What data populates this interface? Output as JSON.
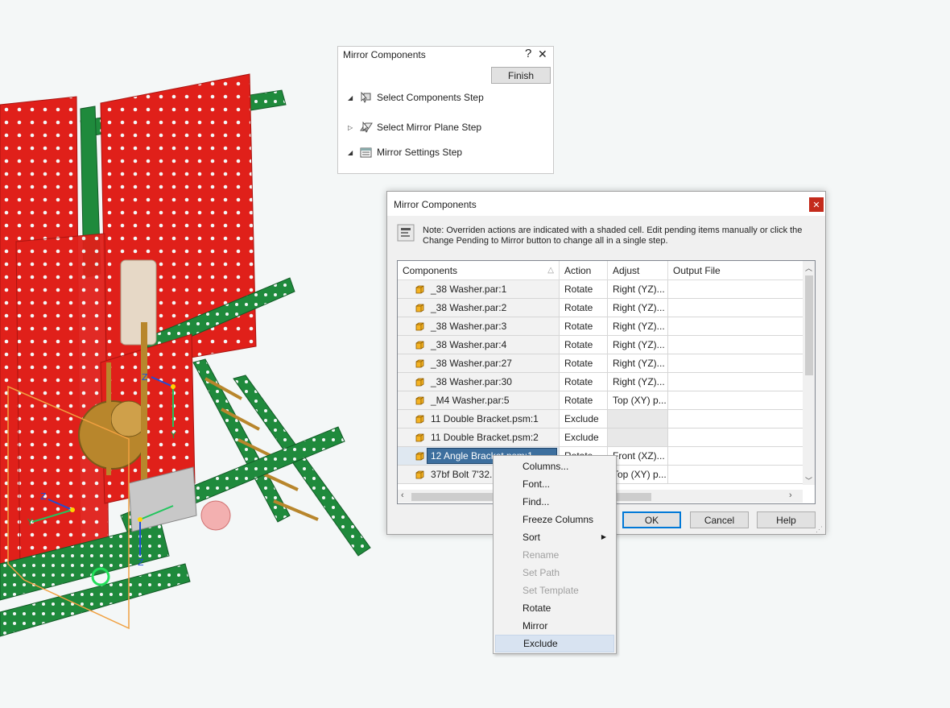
{
  "wizard": {
    "title": "Mirror Components",
    "help_glyph": "?",
    "close_glyph": "✕",
    "finish_label": "Finish",
    "steps": [
      {
        "label": "Select Components Step",
        "state": "expanded",
        "icon": "select-components-icon"
      },
      {
        "label": "Select Mirror Plane Step",
        "state": "collapsed",
        "icon": "mirror-plane-icon"
      },
      {
        "label": "Mirror Settings Step",
        "state": "expanded",
        "icon": "mirror-settings-icon"
      }
    ]
  },
  "dialog": {
    "title": "Mirror Components",
    "close_glyph": "✕",
    "note": "Note: Overriden actions are indicated with a shaded cell. Edit pending items manually or click the Change Pending to Mirror button to change all in a single step.",
    "columns": [
      "Components",
      "Action",
      "Adjust",
      "Output File"
    ],
    "rows": [
      {
        "component": "_38 Washer.par:1",
        "action": "Rotate",
        "adjust": "Right (YZ)...",
        "output": ""
      },
      {
        "component": "_38 Washer.par:2",
        "action": "Rotate",
        "adjust": "Right (YZ)...",
        "output": ""
      },
      {
        "component": "_38 Washer.par:3",
        "action": "Rotate",
        "adjust": "Right (YZ)...",
        "output": ""
      },
      {
        "component": "_38 Washer.par:4",
        "action": "Rotate",
        "adjust": "Right (YZ)...",
        "output": ""
      },
      {
        "component": "_38 Washer.par:27",
        "action": "Rotate",
        "adjust": "Right (YZ)...",
        "output": ""
      },
      {
        "component": "_38 Washer.par:30",
        "action": "Rotate",
        "adjust": "Right (YZ)...",
        "output": ""
      },
      {
        "component": "_M4 Washer.par:5",
        "action": "Rotate",
        "adjust": "Top (XY) p...",
        "output": ""
      },
      {
        "component": "11 Double Bracket.psm:1",
        "action": "Exclude",
        "adjust": "",
        "output": ""
      },
      {
        "component": "11 Double Bracket.psm:2",
        "action": "Exclude",
        "adjust": "",
        "output": ""
      },
      {
        "component": "12 Angle Bracket.psm:1",
        "action": "Rotate",
        "adjust": "Front (XZ)...",
        "output": ""
      },
      {
        "component": "37bf Bolt 7'32.par:1",
        "action": "Rotate",
        "adjust": "Top (XY) p...",
        "output": ""
      }
    ],
    "selected_row": 9,
    "buttons": {
      "ok": "OK",
      "cancel": "Cancel",
      "help": "Help"
    }
  },
  "context_menu": {
    "items": [
      {
        "label": "Columns...",
        "enabled": true
      },
      {
        "label": "Font...",
        "enabled": true
      },
      {
        "label": "Find...",
        "enabled": true
      },
      {
        "label": "Freeze Columns",
        "enabled": true
      },
      {
        "label": "Sort",
        "enabled": true,
        "submenu": true
      },
      {
        "label": "Rename",
        "enabled": false
      },
      {
        "label": "Set Path",
        "enabled": false
      },
      {
        "label": "Set Template",
        "enabled": false
      },
      {
        "label": "Rotate",
        "enabled": true
      },
      {
        "label": "Mirror",
        "enabled": true
      },
      {
        "label": "Exclude",
        "enabled": true,
        "hovered": true
      }
    ]
  },
  "viewport": {
    "triad_labels": {
      "x": "X",
      "y": "Y",
      "z": "Z"
    }
  },
  "colors": {
    "panel_red": "#e0201a",
    "frame_green": "#1f8a3c",
    "brass": "#b8862c",
    "selection_blue": "#3d6f9e",
    "menu_hover": "#d8e3f1",
    "close_red": "#c42b1c",
    "default_button_border": "#0078d7"
  }
}
